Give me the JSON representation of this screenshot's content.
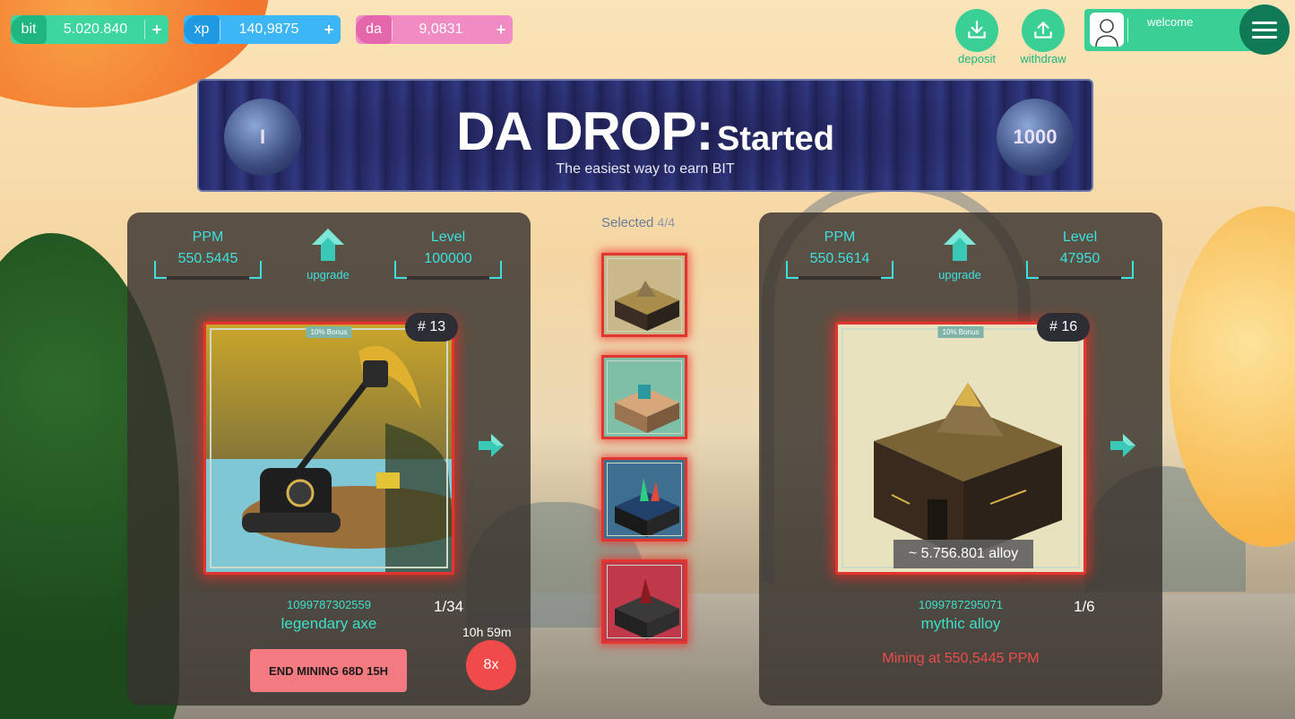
{
  "currencies": [
    {
      "tag": "bit",
      "value": "5.020.840",
      "plus": "+"
    },
    {
      "tag": "xp",
      "value": "140,9875",
      "plus": "+"
    },
    {
      "tag": "da",
      "value": "9,0831",
      "plus": "+"
    }
  ],
  "actions": {
    "deposit": "deposit",
    "withdraw": "withdraw"
  },
  "user": {
    "welcome": "welcome"
  },
  "banner": {
    "title": "DA DROP:",
    "status": "Started",
    "subtitle": "The easiest way to earn BIT",
    "left_coin": "I",
    "right_coin": "1000"
  },
  "left_panel": {
    "ppm_label": "PPM",
    "ppm_value": "550.5445",
    "upgrade": "upgrade",
    "level_label": "Level",
    "level_value": "100000",
    "badge": "# 13",
    "bonus": "10% Bonus",
    "nft_id": "1099787302559",
    "nft_name": "legendary axe",
    "count": "1/34",
    "end_mining": "END MINING 68D 15H",
    "timer": "10h 59m",
    "multiplier": "8x"
  },
  "right_panel": {
    "ppm_label": "PPM",
    "ppm_value": "550.5614",
    "upgrade": "upgrade",
    "level_label": "Level",
    "level_value": "47950",
    "badge": "# 16",
    "bonus": "10% Bonus",
    "alloy": "~ 5.756.801 alloy",
    "nft_id": "1099787295071",
    "nft_name": "mythic alloy",
    "count": "1/6",
    "mining_at": "Mining at 550,5445 PPM"
  },
  "selected": {
    "label": "Selected",
    "count": "4/4"
  },
  "colors": {
    "accent": "#3ce0e0",
    "green": "#39cf95",
    "red": "#e3352f"
  }
}
